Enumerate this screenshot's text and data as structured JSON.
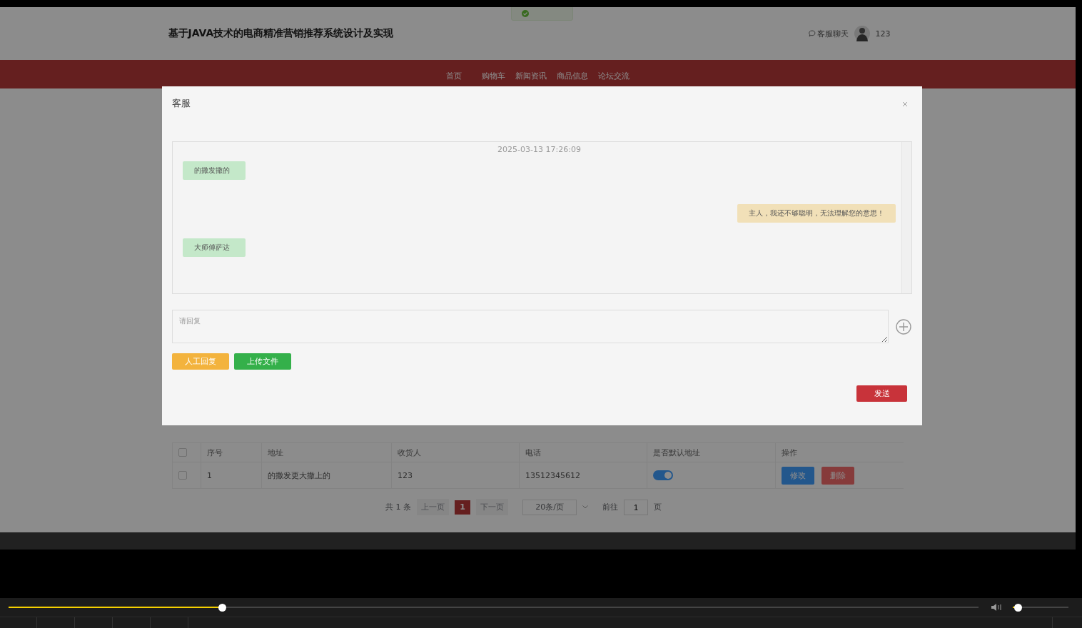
{
  "page": {
    "title": "基于JAVA技术的电商精准营销推荐系统设计及实现",
    "chat_link": "客服聊天",
    "user": "123",
    "nav": [
      {
        "label": "首页"
      },
      {
        "label": "购物车"
      },
      {
        "label": "新闻资讯"
      },
      {
        "label": "商品信息"
      },
      {
        "label": "论坛交流"
      }
    ]
  },
  "table": {
    "all_checked": false,
    "columns": [
      "序号",
      "地址",
      "收货人",
      "电话",
      "是否默认地址",
      "操作"
    ],
    "rows": [
      {
        "checked": false,
        "cells": [
          "1",
          "的撒发更大撒上的",
          "123",
          "13512345612"
        ],
        "default_on": true,
        "actions": [
          {
            "label": "修改",
            "kind": "edit"
          },
          {
            "label": "删除",
            "kind": "delete"
          }
        ]
      }
    ]
  },
  "pagination": {
    "total": "共 1 条",
    "prev": "上一页",
    "pages": [
      {
        "label": "1",
        "selected": true
      }
    ],
    "next": "下一页",
    "page_size": "20条/页",
    "goto": "前往",
    "goto_value": "1",
    "unit": "页"
  },
  "dialog": {
    "title": "客服",
    "timestamp": "2025-03-13 17:26:09",
    "messages": [
      {
        "text": "的撒发撒的",
        "kind": "user"
      },
      {
        "text": "主人，我还不够聪明，无法理解您的意思！",
        "kind": "bot"
      },
      {
        "text": "大师傅萨达",
        "kind": "user"
      }
    ],
    "reply_placeholder": "请回复",
    "buttons": [
      {
        "label": "人工回复",
        "kind": "manual"
      },
      {
        "label": "上传文件",
        "kind": "upload"
      }
    ],
    "send": "发送"
  },
  "player": {
    "progress": {
      "level": 0.22
    },
    "volume": {
      "level": 0.1
    }
  }
}
